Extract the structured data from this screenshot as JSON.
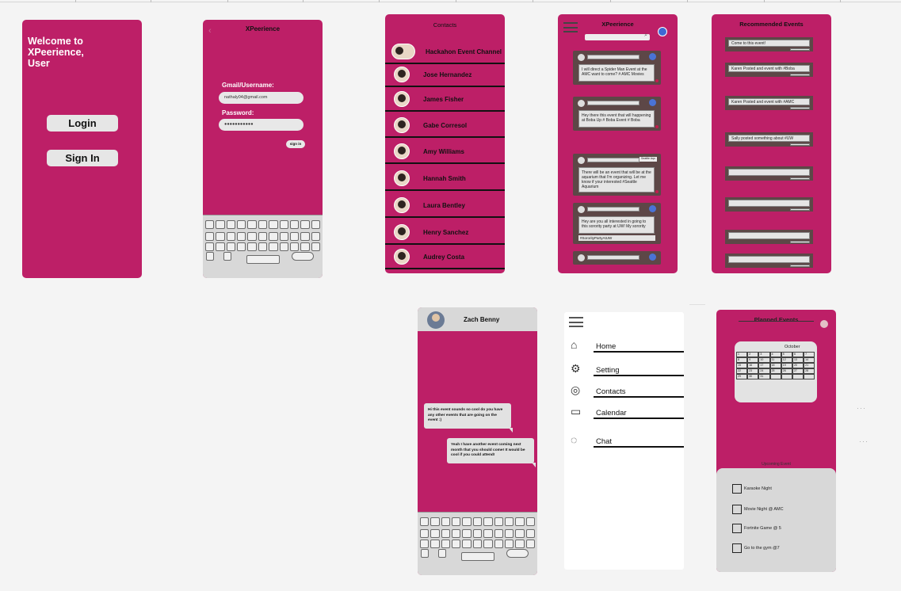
{
  "welcome": {
    "heading": "Welcome to XPeerience, User",
    "login_label": "Login",
    "signin_label": "Sign In"
  },
  "login_form": {
    "title": "XPeerience",
    "username_label": "Gmail/Username:",
    "username_value": "nathaly04@gmail.com",
    "password_label": "Password:",
    "password_value": "●●●●●●●●●●●",
    "signin_label": "sign in"
  },
  "contacts": {
    "title": "Contacts",
    "items": [
      "Hackahon Event Channel",
      "Jose Hernandez",
      "James Fisher",
      "Gabe Corresol",
      "Amy Williams",
      "Hannah Smith",
      "Laura Bentley",
      "Henry Sanchez",
      "Audrey Costa"
    ]
  },
  "feed": {
    "title": "XPeerience",
    "posts": [
      "I will direct a Spider Man Event at the AMC want to come? # AMC Movies",
      "Hey there this event that will happening at Boba Up # Boba Event # Boba",
      "There will be an event that will be at the aquarium that I'm organizing. Let me know if your interested #Seattle Aquarium",
      "Hey are you all interested in going to this sorority party at UW! My sorority",
      ""
    ],
    "post3_button": "Seattle Aqu",
    "post4_tag": "#SororityPartyAtUW"
  },
  "recommended": {
    "title": "Recommended Events",
    "items": [
      "Come to this event!",
      "Karen Posted and event with #Boba",
      "Karen Posted and event with #AMC",
      "Sally posted something about #UW",
      "",
      "",
      "",
      ""
    ],
    "button_label": "Look more"
  },
  "chat": {
    "name": "Zach Benny",
    "messages": [
      "Hi this event sounds so cool do you have any other events that are going on the event :)",
      "Yeah I have another event coming next month that you should come! It would be cool if you could attend!"
    ]
  },
  "menu": {
    "items": [
      {
        "label": "Home",
        "icon": "home-icon"
      },
      {
        "label": "Setting",
        "icon": "gear-icon"
      },
      {
        "label": "Contacts",
        "icon": "contacts-icon"
      },
      {
        "label": "Calendar",
        "icon": "calendar-icon"
      },
      {
        "label": "Chat",
        "icon": "chat-icon"
      }
    ]
  },
  "planned": {
    "title": "Planned Events",
    "month": "October",
    "days": [
      "1",
      "2",
      "3",
      "4",
      "5",
      "6",
      "7",
      "8",
      "9",
      "10",
      "11",
      "12",
      "13",
      "14",
      "15",
      "16",
      "17",
      "18",
      "19",
      "20",
      "21",
      "22",
      "23",
      "24",
      "25",
      "26",
      "27",
      "28",
      "29",
      "30",
      "31",
      "",
      "",
      "",
      ""
    ],
    "upcoming_label": "Upcoming Event",
    "events": [
      "Karaoke Night",
      "Movie Night @ AMC",
      "Fortnite Game @ 5",
      "Go to the gym @7"
    ]
  },
  "colors": {
    "primary": "#bd1f67",
    "post_bg": "#5d4747",
    "canvas": "#f4f4f4"
  }
}
